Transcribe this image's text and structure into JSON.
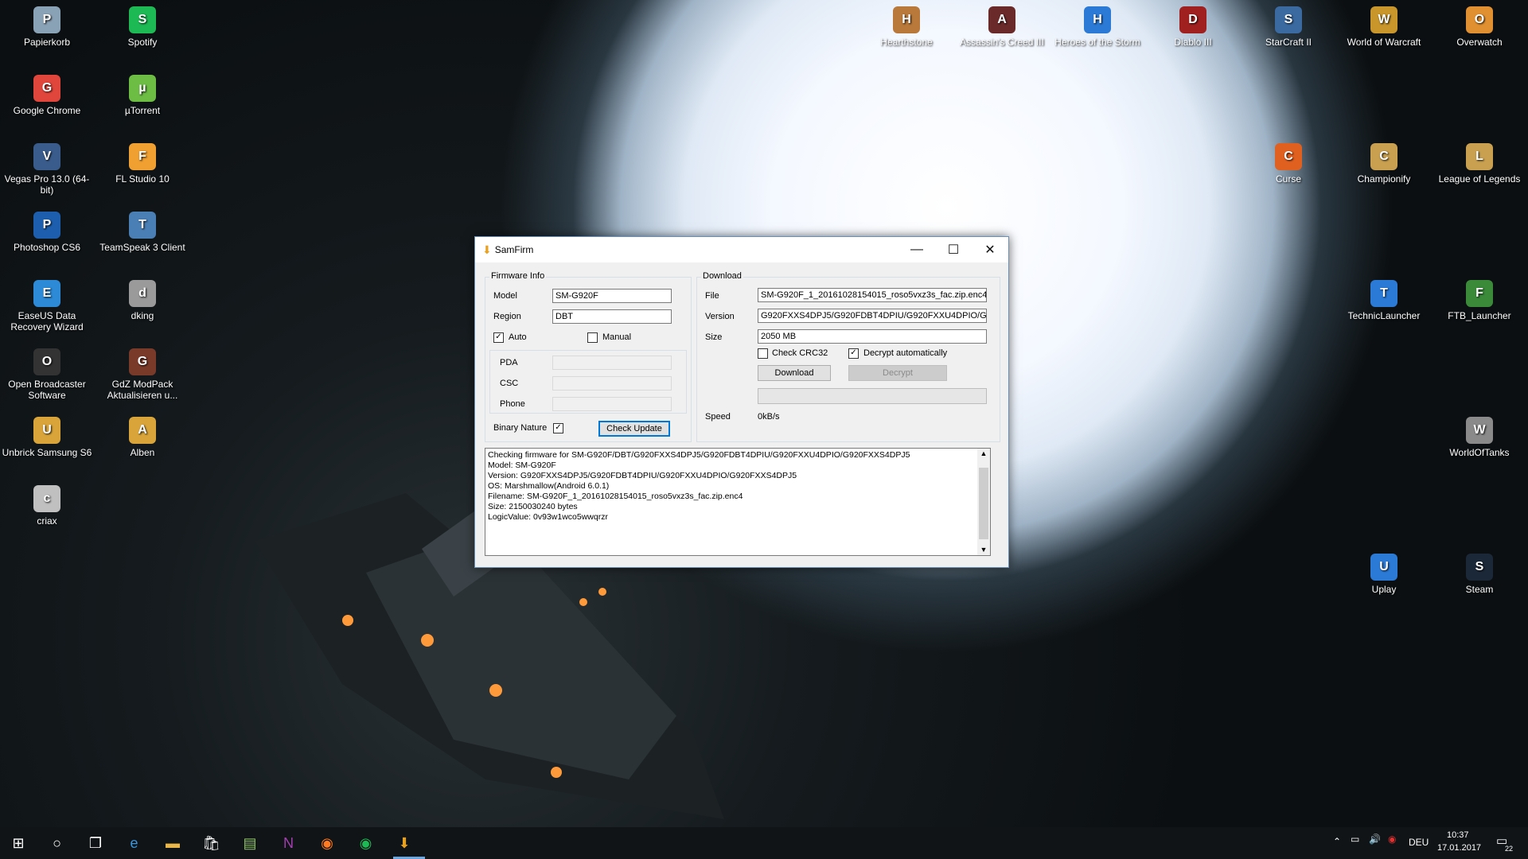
{
  "desktop_icons": [
    {
      "label": "Papierkorb",
      "icon": "recycle-bin-icon",
      "color": "#8aa2b5"
    },
    {
      "label": "Spotify",
      "icon": "spotify-icon",
      "color": "#1db954"
    },
    {
      "label": "Google Chrome",
      "icon": "chrome-icon",
      "color": "#e0463b"
    },
    {
      "label": "µTorrent",
      "icon": "utorrent-icon",
      "color": "#6dbd45"
    },
    {
      "label": "Vegas Pro 13.0 (64-bit)",
      "icon": "vegas-icon",
      "color": "#3a5c8c"
    },
    {
      "label": "FL Studio 10",
      "icon": "fl-studio-icon",
      "color": "#f0a030"
    },
    {
      "label": "Photoshop CS6",
      "icon": "photoshop-icon",
      "color": "#1d5fae"
    },
    {
      "label": "TeamSpeak 3 Client",
      "icon": "teamspeak-icon",
      "color": "#4a7fb5"
    },
    {
      "label": "EaseUS Data Recovery Wizard",
      "icon": "easeus-icon",
      "color": "#2d8ad6"
    },
    {
      "label": "dking",
      "icon": "image-file-icon",
      "color": "#9a9a9a"
    },
    {
      "label": "Open Broadcaster Software",
      "icon": "obs-icon",
      "color": "#333333"
    },
    {
      "label": "GdZ ModPack Aktualisieren u...",
      "icon": "modpack-icon",
      "color": "#7a3a2a"
    },
    {
      "label": "Unbrick Samsung S6",
      "icon": "archive-icon",
      "color": "#d9a53a"
    },
    {
      "label": "Alben",
      "icon": "folder-icon",
      "color": "#d9a53a"
    },
    {
      "label": "criax",
      "icon": "image-file-icon",
      "color": "#c0c0c0"
    },
    {
      "label": "Hearthstone",
      "icon": "hearthstone-icon",
      "color": "#b8793a"
    },
    {
      "label": "Assassin's Creed III",
      "icon": "assassins-creed-icon",
      "color": "#6a2a2a"
    },
    {
      "label": "Heroes of the Storm",
      "icon": "heroes-icon",
      "color": "#2a7ad6"
    },
    {
      "label": "Diablo III",
      "icon": "diablo-icon",
      "color": "#a02020"
    },
    {
      "label": "StarCraft II",
      "icon": "starcraft-icon",
      "color": "#3a6aa0"
    },
    {
      "label": "World of Warcraft",
      "icon": "wow-icon",
      "color": "#c8962a"
    },
    {
      "label": "Overwatch",
      "icon": "overwatch-icon",
      "color": "#e09030"
    },
    {
      "label": "Curse",
      "icon": "curse-icon",
      "color": "#e06020"
    },
    {
      "label": "Championify",
      "icon": "championify-icon",
      "color": "#c8a050"
    },
    {
      "label": "League of Legends",
      "icon": "lol-icon",
      "color": "#c8a050"
    },
    {
      "label": "TechnicLauncher",
      "icon": "technic-icon",
      "color": "#2a7ad6"
    },
    {
      "label": "FTB_Launcher",
      "icon": "ftb-icon",
      "color": "#3a8a3a"
    },
    {
      "label": "WorldOfTanks",
      "icon": "wot-icon",
      "color": "#8a8a8a"
    },
    {
      "label": "Uplay",
      "icon": "uplay-icon",
      "color": "#2a7ad6"
    },
    {
      "label": "Steam",
      "icon": "steam-icon",
      "color": "#1b2838"
    }
  ],
  "window": {
    "title": "SamFirm",
    "firmware_group": "Firmware Info",
    "model_label": "Model",
    "model_value": "SM-G920F",
    "region_label": "Region",
    "region_value": "DBT",
    "auto_label": "Auto",
    "auto_checked": true,
    "manual_label": "Manual",
    "manual_checked": false,
    "pda_label": "PDA",
    "csc_label": "CSC",
    "phone_label": "Phone",
    "binary_label": "Binary Nature",
    "binary_checked": true,
    "check_update_label": "Check Update",
    "download_group": "Download",
    "file_label": "File",
    "file_value": "SM-G920F_1_20161028154015_roso5vxz3s_fac.zip.enc4",
    "version_label": "Version",
    "version_value": "G920FXXS4DPJ5/G920FDBT4DPIU/G920FXXU4DPIO/G920FXXS4DPJ5",
    "size_label": "Size",
    "size_value": "2050 MB",
    "crc_label": "Check CRC32",
    "crc_checked": false,
    "decrypt_auto_label": "Decrypt automatically",
    "decrypt_auto_checked": true,
    "download_button": "Download",
    "decrypt_button": "Decrypt",
    "speed_label": "Speed",
    "speed_value": "0kB/s",
    "log_lines": [
      "Checking firmware for SM-G920F/DBT/G920FXXS4DPJ5/G920FDBT4DPIU/G920FXXU4DPIO/G920FXXS4DPJ5",
      "Model: SM-G920F",
      "Version: G920FXXS4DPJ5/G920FDBT4DPIU/G920FXXU4DPIO/G920FXXS4DPJ5",
      "OS: Marshmallow(Android 6.0.1)",
      "Filename: SM-G920F_1_20161028154015_roso5vxz3s_fac.zip.enc4",
      "Size: 2150030240 bytes",
      "LogicValue: 0v93w1wco5wwqrzr"
    ]
  },
  "taskbar": {
    "apps": [
      "start-icon",
      "cortana-icon",
      "task-view-icon",
      "edge-icon",
      "explorer-icon",
      "store-icon",
      "notepad-icon",
      "onenote-icon",
      "firefox-icon",
      "spotify-icon",
      "samfirm-icon"
    ],
    "lang": "DEU",
    "time": "10:37",
    "date": "17.01.2017",
    "notifications": "22"
  }
}
